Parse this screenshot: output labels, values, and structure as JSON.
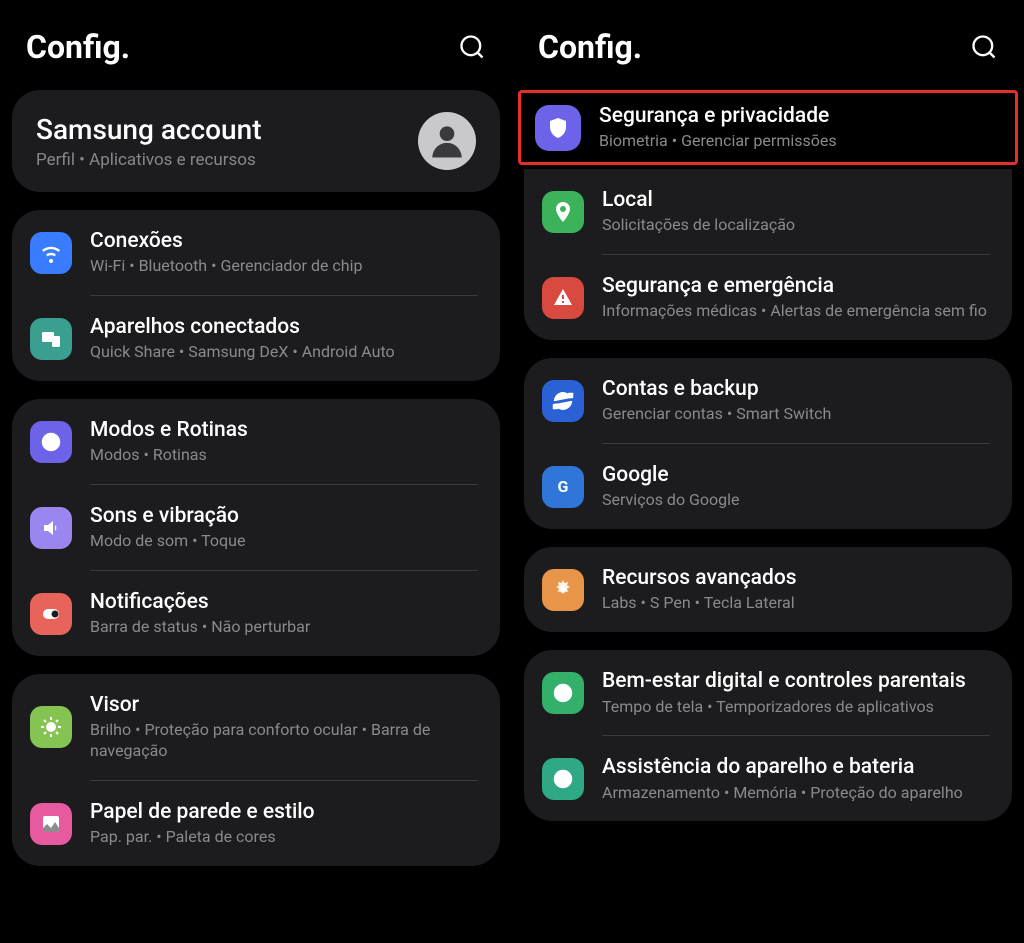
{
  "left": {
    "header": "Config.",
    "account": {
      "title": "Samsung account",
      "sub": "Perfil  •  Aplicativos e recursos"
    },
    "groups": [
      [
        {
          "id": "conexoes",
          "title": "Conexões",
          "sub": "Wi-Fi  •  Bluetooth  •  Gerenciador de chip"
        },
        {
          "id": "aparelhos",
          "title": "Aparelhos conectados",
          "sub": "Quick Share  •  Samsung DeX  •  Android Auto"
        }
      ],
      [
        {
          "id": "modos",
          "title": "Modos e Rotinas",
          "sub": "Modos  •  Rotinas"
        },
        {
          "id": "sons",
          "title": "Sons e vibração",
          "sub": "Modo de som  •  Toque"
        },
        {
          "id": "notif",
          "title": "Notificações",
          "sub": "Barra de status  •  Não perturbar"
        }
      ],
      [
        {
          "id": "visor",
          "title": "Visor",
          "sub": "Brilho  •  Proteção para conforto ocular  •  Barra de navegação"
        },
        {
          "id": "papel",
          "title": "Papel de parede e estilo",
          "sub": "Pap. par.  •  Paleta de cores"
        }
      ]
    ]
  },
  "right": {
    "header": "Config.",
    "highlighted": {
      "id": "seguranca",
      "title": "Segurança e privacidade",
      "sub": "Biometria  •  Gerenciar permissões"
    },
    "groups": [
      [
        {
          "id": "local",
          "title": "Local",
          "sub": "Solicitações de localização"
        },
        {
          "id": "emerg",
          "title": "Segurança e emergência",
          "sub": "Informações médicas  •  Alertas de emergência sem fio"
        }
      ],
      [
        {
          "id": "contas",
          "title": "Contas e backup",
          "sub": "Gerenciar contas  •  Smart Switch"
        },
        {
          "id": "google",
          "title": "Google",
          "sub": "Serviços do Google"
        }
      ],
      [
        {
          "id": "recursos",
          "title": "Recursos avançados",
          "sub": "Labs  •  S Pen  •  Tecla Lateral"
        }
      ],
      [
        {
          "id": "bemestar",
          "title": "Bem-estar digital e controles parentais",
          "sub": "Tempo de tela  •  Temporizadores de aplicativos"
        },
        {
          "id": "assist",
          "title": "Assistência do aparelho e bateria",
          "sub": "Armazenamento  •  Memória  •  Proteção do aparelho"
        }
      ]
    ]
  }
}
